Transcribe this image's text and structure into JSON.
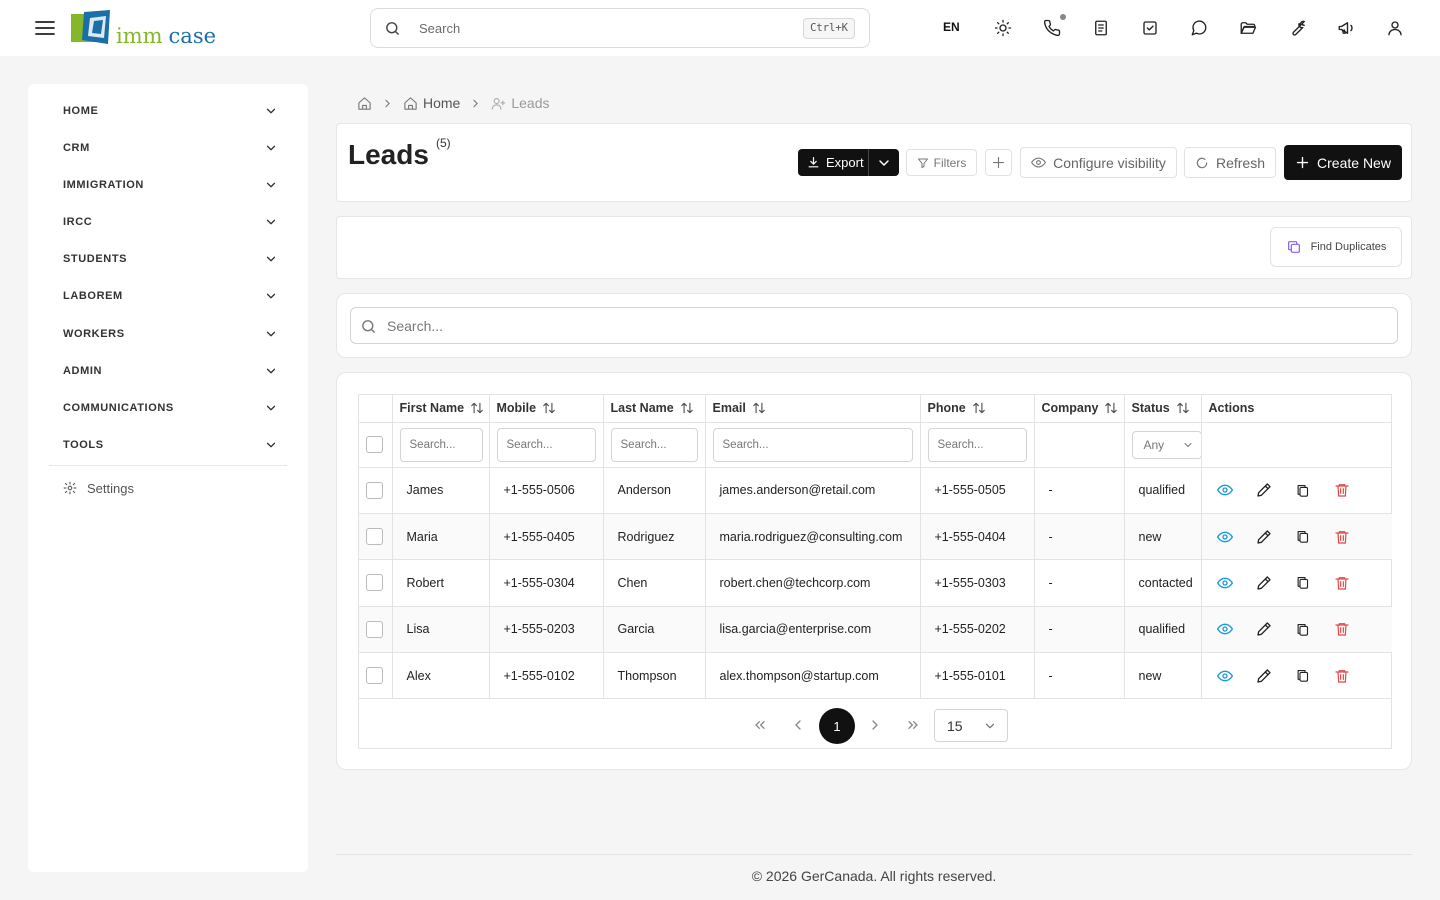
{
  "topbar": {
    "logo_text_a": "imm",
    "logo_text_b": "case",
    "search_placeholder": "Search",
    "search_shortcut": "Ctrl+K",
    "language": "EN"
  },
  "sidebar": {
    "items": [
      {
        "label": "HOME"
      },
      {
        "label": "CRM"
      },
      {
        "label": "IMMIGRATION"
      },
      {
        "label": "IRCC"
      },
      {
        "label": "STUDENTS"
      },
      {
        "label": "LABOREM"
      },
      {
        "label": "WORKERS"
      },
      {
        "label": "ADMIN"
      },
      {
        "label": "COMMUNICATIONS"
      },
      {
        "label": "TOOLS"
      }
    ],
    "settings_label": "Settings"
  },
  "breadcrumb": {
    "home": "Home",
    "current": "Leads"
  },
  "header": {
    "title": "Leads",
    "count": "(5)",
    "export_label": "Export",
    "filters_label": "Filters",
    "visibility_label": "Configure visibility",
    "refresh_label": "Refresh",
    "create_label": "Create New"
  },
  "duplicates": {
    "label": "Find Duplicates"
  },
  "table_search": {
    "placeholder": "Search..."
  },
  "table": {
    "columns": {
      "first_name": "First Name",
      "mobile": "Mobile",
      "last_name": "Last Name",
      "email": "Email",
      "phone": "Phone",
      "company": "Company",
      "status": "Status",
      "actions": "Actions"
    },
    "filter_placeholder": "Search...",
    "status_filter_value": "Any",
    "rows": [
      {
        "first_name": "James",
        "mobile": "+1-555-0506",
        "last_name": "Anderson",
        "email": "james.anderson@retail.com",
        "phone": "+1-555-0505",
        "company": "-",
        "status": "qualified"
      },
      {
        "first_name": "Maria",
        "mobile": "+1-555-0405",
        "last_name": "Rodriguez",
        "email": "maria.rodriguez@consulting.com",
        "phone": "+1-555-0404",
        "company": "-",
        "status": "new"
      },
      {
        "first_name": "Robert",
        "mobile": "+1-555-0304",
        "last_name": "Chen",
        "email": "robert.chen@techcorp.com",
        "phone": "+1-555-0303",
        "company": "-",
        "status": "contacted"
      },
      {
        "first_name": "Lisa",
        "mobile": "+1-555-0203",
        "last_name": "Garcia",
        "email": "lisa.garcia@enterprise.com",
        "phone": "+1-555-0202",
        "company": "-",
        "status": "qualified"
      },
      {
        "first_name": "Alex",
        "mobile": "+1-555-0102",
        "last_name": "Thompson",
        "email": "alex.thompson@startup.com",
        "phone": "+1-555-0101",
        "company": "-",
        "status": "new"
      }
    ]
  },
  "pagination": {
    "current_page": "1",
    "page_size": "15"
  },
  "footer": {
    "text": "© 2026 GerCanada. All rights reserved."
  },
  "colors": {
    "primary_button": "#111111",
    "view_icon": "#1a9bd7",
    "delete_icon": "#e04848",
    "duplicate_icon": "#8b5cf6",
    "logo_green": "#86b72a",
    "logo_blue": "#1a6fa8"
  }
}
